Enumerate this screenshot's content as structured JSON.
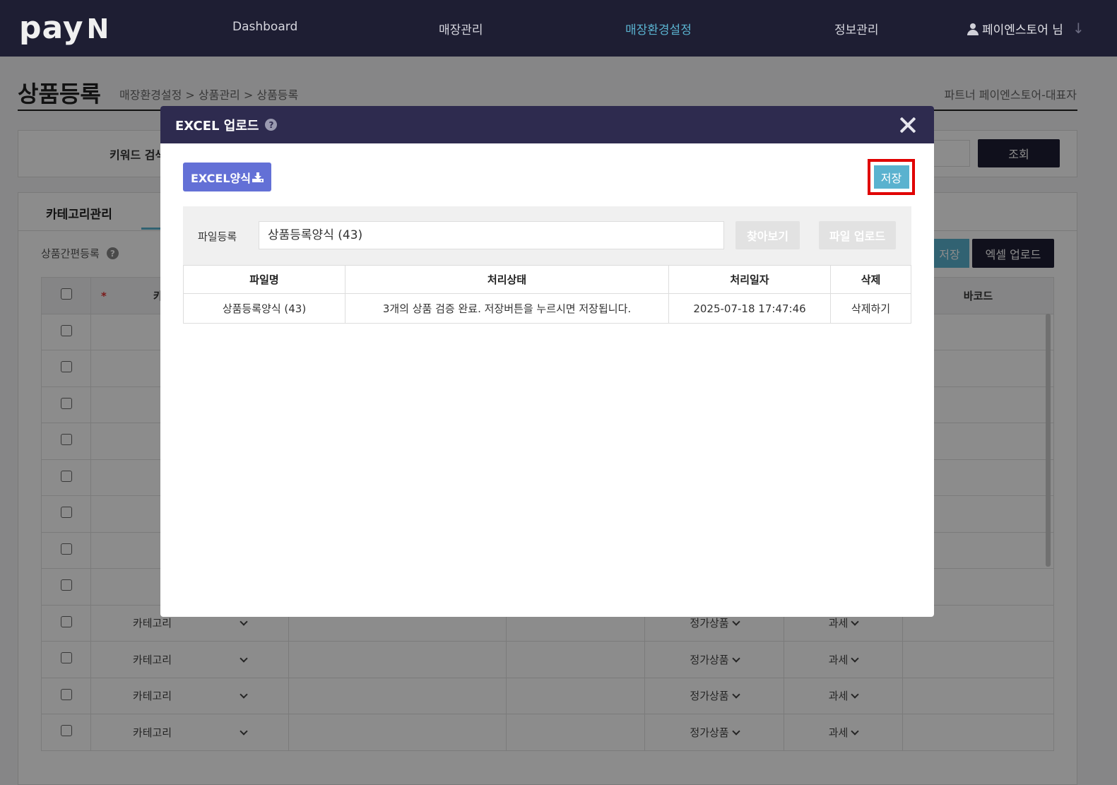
{
  "logo": {
    "text": "pay",
    "suffix": "N"
  },
  "nav": {
    "items": [
      {
        "label": "Dashboard",
        "active": false
      },
      {
        "label": "매장관리",
        "active": false
      },
      {
        "label": "매장환경설정",
        "active": true
      },
      {
        "label": "정보관리",
        "active": false
      }
    ],
    "user": "페이엔스토어 님",
    "down_arrow": "↓"
  },
  "page": {
    "title": "상품등록",
    "breadcrumb": "매장환경설정 > 상품관리 > 상품등록",
    "partner": "파트너 페이엔스토어-대표자"
  },
  "search": {
    "keyword_label": "키워드 검색",
    "search_button": "조회"
  },
  "panel": {
    "tab_label": "카테고리관리",
    "quick_register": "상품간편등록",
    "help_icon": "?",
    "save_button": "저장",
    "excel_upload_button": "엑셀 업로드"
  },
  "bg_table": {
    "required_mark": "*",
    "col_category_partial": "카",
    "col_barcode": "바코드",
    "rows": [
      {
        "category": "카테고리",
        "type": "정가상품",
        "tax": "과세"
      },
      {
        "category": "카테고리",
        "type": "정가상품",
        "tax": "과세"
      },
      {
        "category": "카테고리",
        "type": "정가상품",
        "tax": "과세"
      },
      {
        "category": "카테고리",
        "type": "정가상품",
        "tax": "과세"
      }
    ]
  },
  "modal": {
    "title": "EXCEL 업로드",
    "help_icon": "?",
    "excel_template_button": "EXCEL양식",
    "save_button": "저장",
    "file_label": "파일등록",
    "file_value": "상품등록양식 (43)",
    "browse_button": "찾아보기",
    "upload_button": "파일 업로드",
    "columns": [
      "파일명",
      "처리상태",
      "처리일자",
      "삭제"
    ],
    "rows": [
      {
        "file_name": "상품등록양식 (43)",
        "status": "3개의 상품 검증 완료. 저장버튼을 누르시면 저장됩니다.",
        "date": "2025-07-18 17:47:46",
        "delete": "삭제하기"
      }
    ]
  },
  "colors": {
    "nav_bg": "#1e1e33",
    "accent": "#5ab2cf",
    "modal_header": "#2e2b4f",
    "excel_button": "#6370d6",
    "highlight": "#e00000"
  }
}
